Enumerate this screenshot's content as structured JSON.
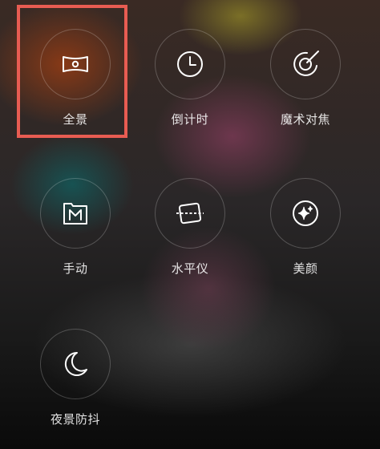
{
  "modes": [
    {
      "label": "全景",
      "icon": "panorama-icon"
    },
    {
      "label": "倒计时",
      "icon": "timer-clock-icon"
    },
    {
      "label": "魔术对焦",
      "icon": "magic-focus-icon"
    },
    {
      "label": "手动",
      "icon": "manual-mode-icon"
    },
    {
      "label": "水平仪",
      "icon": "level-icon"
    },
    {
      "label": "美颜",
      "icon": "beauty-sparkle-icon"
    },
    {
      "label": "夜景防抖",
      "icon": "night-moon-icon"
    }
  ],
  "selection": {
    "highlighted_mode": "全景",
    "color": "#e85c52"
  }
}
